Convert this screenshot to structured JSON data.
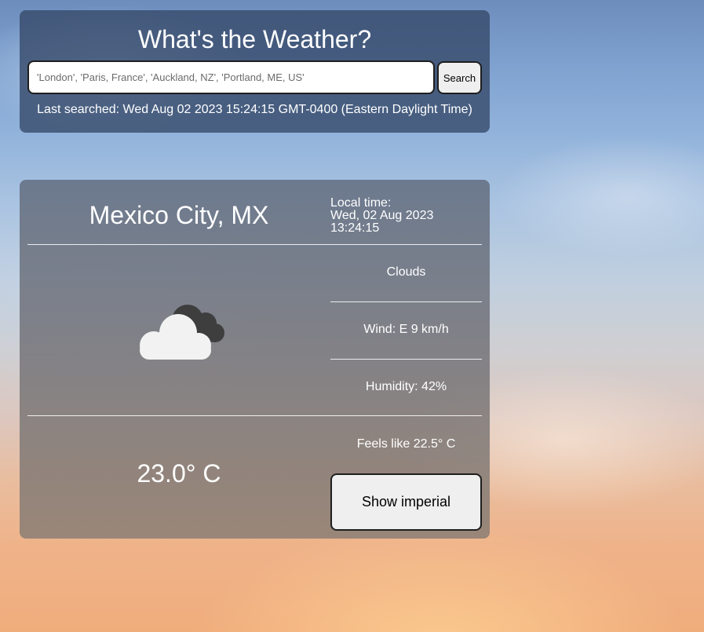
{
  "search": {
    "title": "What's the Weather?",
    "placeholder": "'London', 'Paris, France', 'Auckland, NZ', 'Portland, ME, US'",
    "button_label": "Search",
    "last_searched": "Last searched: Wed Aug 02 2023 15:24:15 GMT-0400 (Eastern Daylight Time)"
  },
  "weather": {
    "city": "Mexico City, MX",
    "local_time_label": "Local time:",
    "local_date": "Wed, 02 Aug 2023",
    "local_clock": "13:24:15",
    "icon": "clouds-icon",
    "condition": "Clouds",
    "wind": "Wind: E 9 km/h",
    "humidity": "Humidity: 42%",
    "feels_like": "Feels like 22.5° C",
    "temperature": "23.0° C",
    "unit_toggle_label": "Show imperial"
  },
  "colors": {
    "search_panel": "#344868",
    "weather_panel": "#6e717a",
    "button_bg": "#efefef",
    "text": "#ffffff"
  }
}
